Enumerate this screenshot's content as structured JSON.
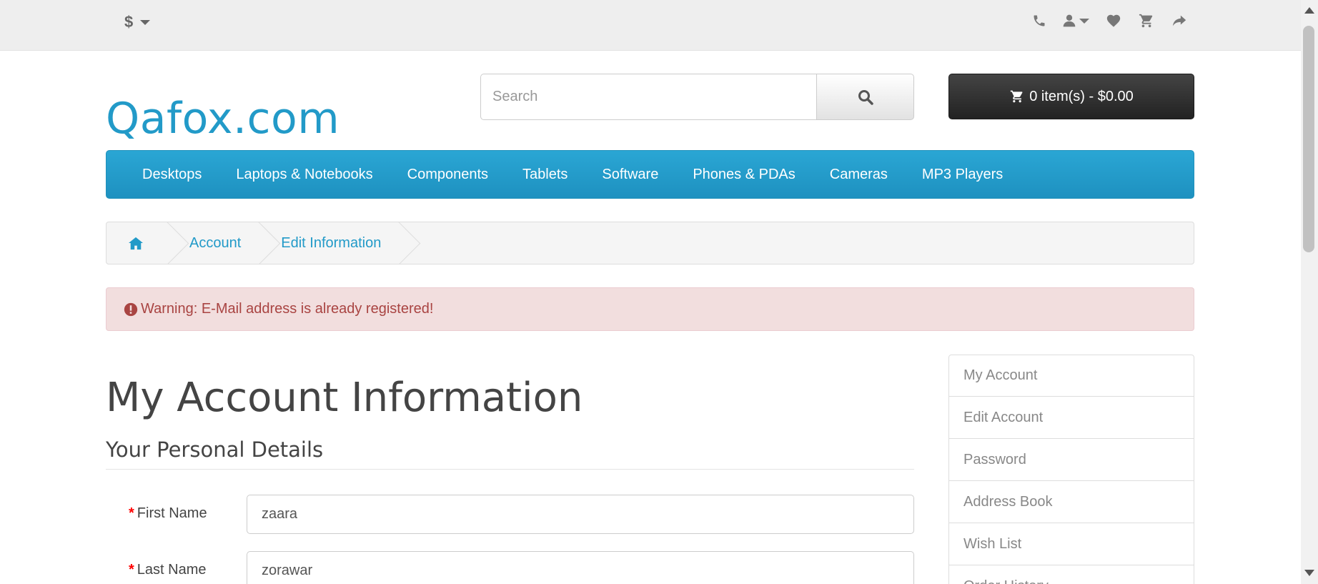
{
  "topbar": {
    "currency_symbol": "$",
    "icons": [
      "phone-icon",
      "user-icon",
      "heart-icon",
      "cart-icon",
      "share-icon"
    ]
  },
  "header": {
    "logo": "Qafox.com",
    "search_placeholder": "Search",
    "cart_label": "0 item(s) - $0.00"
  },
  "menu": {
    "items": [
      "Desktops",
      "Laptops & Notebooks",
      "Components",
      "Tablets",
      "Software",
      "Phones & PDAs",
      "Cameras",
      "MP3 Players"
    ]
  },
  "breadcrumb": {
    "items": [
      "Account",
      "Edit Information"
    ]
  },
  "alert": {
    "text": "Warning: E-Mail address is already registered!"
  },
  "main": {
    "title": "My Account Information",
    "section_title": "Your Personal Details",
    "fields": {
      "first_name_label": "First Name",
      "first_name_value": "zaara",
      "last_name_label": "Last Name",
      "last_name_value": "zorawar"
    }
  },
  "sidebar": {
    "items": [
      "My Account",
      "Edit Account",
      "Password",
      "Address Book",
      "Wish List",
      "Order History"
    ]
  },
  "colors": {
    "brand": "#229ac8",
    "alert_bg": "#f2dede",
    "alert_text": "#a94442"
  }
}
